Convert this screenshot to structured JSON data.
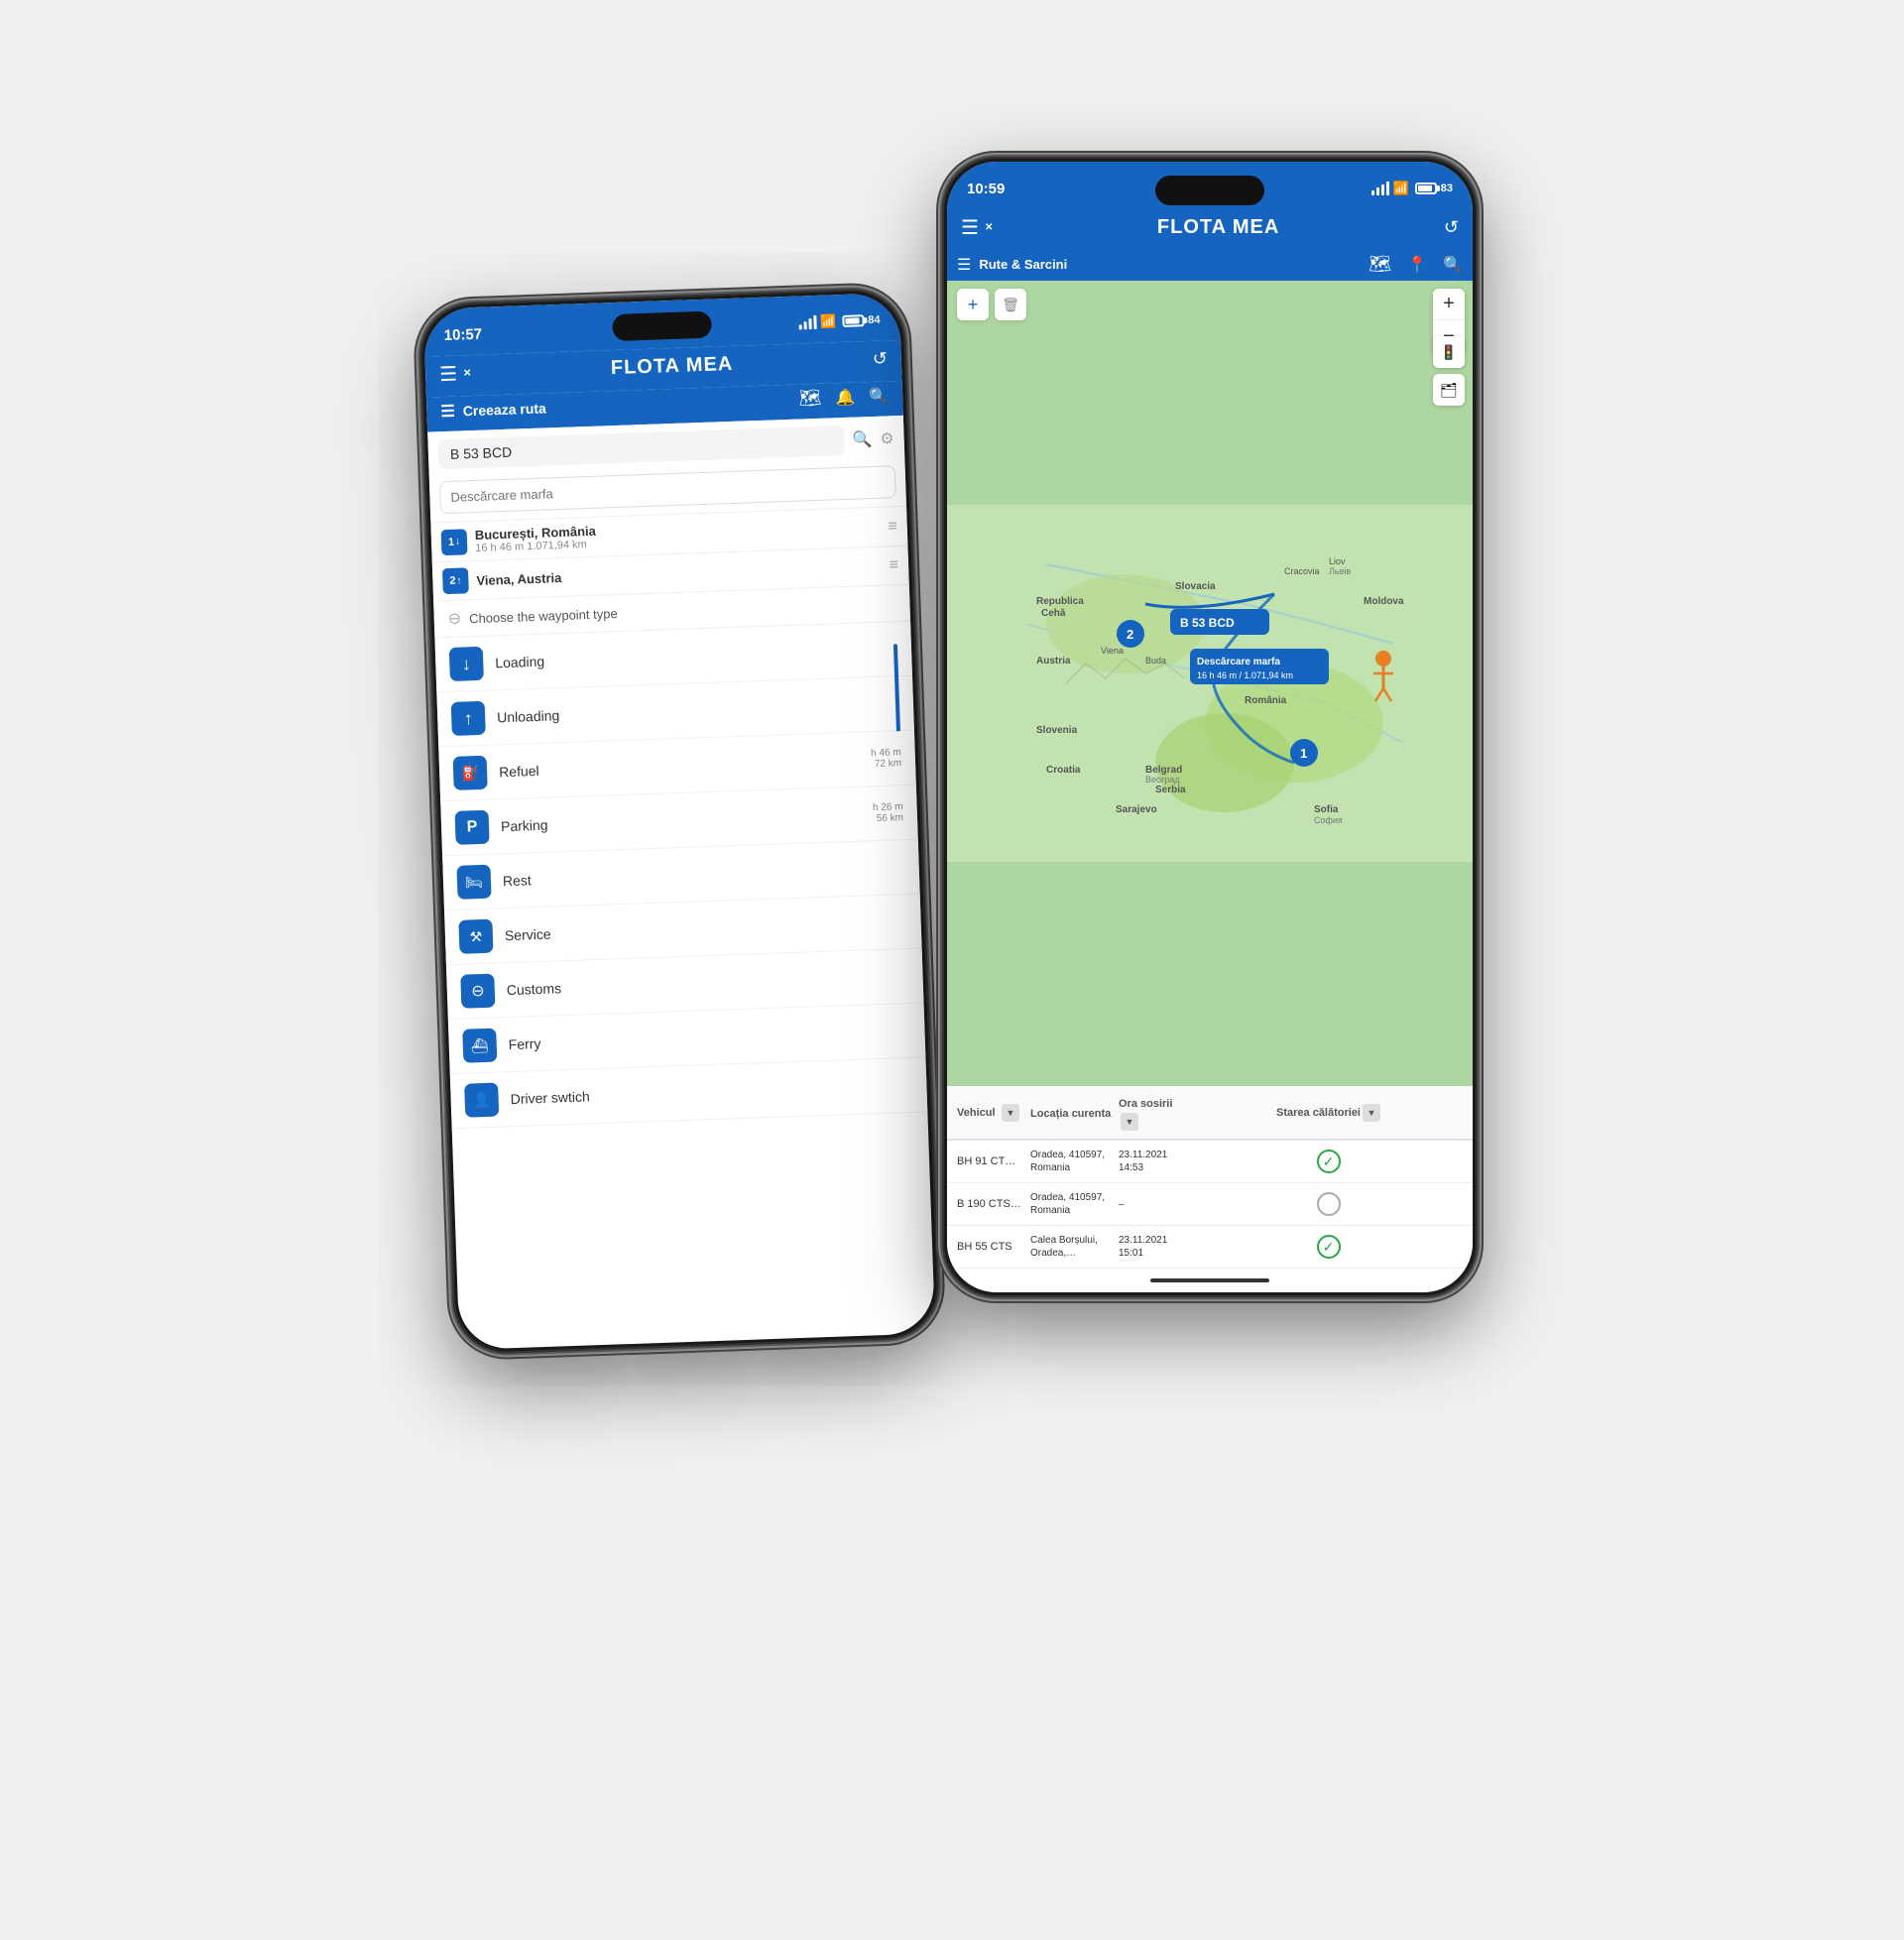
{
  "phones": {
    "left": {
      "time": "10:57",
      "battery": "84",
      "appTitle": "FLOTA MEA",
      "subTitle": "Creeaza ruta",
      "searchValue": "B 53 BCD",
      "descPlaceholder": "Descărcare marfa",
      "waypoints": [
        {
          "num": "1",
          "arrow": "↓",
          "name": "București, România",
          "time": "16 h 46 m 1.071,94 km"
        },
        {
          "num": "2",
          "arrow": "↑",
          "name": "Viena, Austria",
          "time": ""
        }
      ],
      "waypointTypeHeader": "Choose the waypoint type",
      "waypointTypes": [
        {
          "label": "Loading",
          "icon": "↓"
        },
        {
          "label": "Unloading",
          "icon": "↑"
        },
        {
          "label": "Refuel",
          "icon": "⛽"
        },
        {
          "label": "Parking",
          "icon": "P"
        },
        {
          "label": "Rest",
          "icon": "🛏"
        },
        {
          "label": "Service",
          "icon": "⚒"
        },
        {
          "label": "Customs",
          "icon": "⊖"
        },
        {
          "label": "Ferry",
          "icon": "⛴"
        },
        {
          "label": "Driver swtich",
          "icon": "👤"
        }
      ]
    },
    "right": {
      "time": "10:59",
      "battery": "83",
      "appTitle": "FLOTA MEA",
      "subTitle": "Rute & Sarcini",
      "vehicleBadge": "B 53 BCD",
      "tooltipTitle": "Descărcare marfa",
      "tooltipSub": "16 h 46 m / 1.071,94 km",
      "pin1Label": "1",
      "pin2Label": "2",
      "mapLabels": [
        "Republica Cehă",
        "Slovacia",
        "Austria",
        "Slovenia",
        "Croatia",
        "Serbia",
        "Sarajevo",
        "Belgrad Beoград",
        "Moldova",
        "Sofia София",
        "România",
        "Viena",
        "Buda",
        "Cracovia",
        "Liov Львів"
      ],
      "table": {
        "headers": [
          "Vehicul",
          "Locația curenta",
          "Ora sosirii",
          "Starea călătoriei"
        ],
        "rows": [
          {
            "vehicle": "BH 91 CT…",
            "location": "Oradea, 410597, Romania",
            "time": "23.11.2021 14:53",
            "status": "ok"
          },
          {
            "vehicle": "B 190 CTS…",
            "location": "Oradea, 410597, Romania",
            "time": "–",
            "status": "empty"
          },
          {
            "vehicle": "BH 55 CTS",
            "location": "Calea Borșului, Oradea,…",
            "time": "23.11.2021 15:01",
            "status": "ok"
          }
        ]
      }
    }
  }
}
